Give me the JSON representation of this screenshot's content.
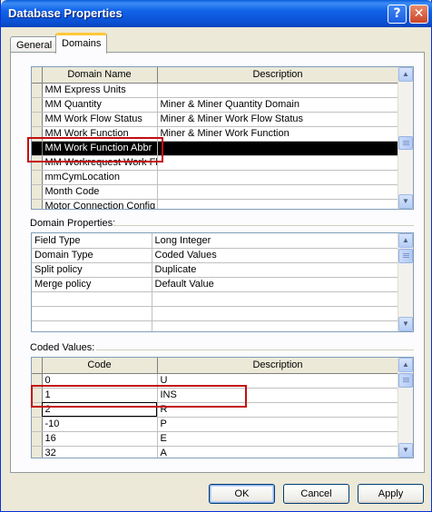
{
  "window": {
    "title": "Database Properties",
    "help_glyph": "?",
    "close_glyph": "✕"
  },
  "tabs": [
    {
      "label": "General",
      "active": false
    },
    {
      "label": "Domains",
      "active": true
    }
  ],
  "domains": {
    "columns": [
      "Domain Name",
      "Description"
    ],
    "rows": [
      {
        "name": "MM Express Units",
        "desc": ""
      },
      {
        "name": "MM Quantity",
        "desc": "Miner & Miner Quantity Domain"
      },
      {
        "name": "MM Work Flow Status",
        "desc": "Miner & Miner Work Flow Status"
      },
      {
        "name": "MM Work Function",
        "desc": "Miner & Miner  Work Function"
      },
      {
        "name": "MM Work Function Abbr",
        "desc": ""
      },
      {
        "name": "MM Workrequest Work Fl",
        "desc": ""
      },
      {
        "name": "mmCymLocation",
        "desc": ""
      },
      {
        "name": "Month Code",
        "desc": ""
      },
      {
        "name": "Motor Connection Config",
        "desc": ""
      }
    ],
    "selected_index": 4
  },
  "domain_properties": {
    "label": "Domain Properties:",
    "rows": [
      {
        "key": "Field Type",
        "value": "Long Integer"
      },
      {
        "key": "Domain Type",
        "value": "Coded Values"
      },
      {
        "key": "Split policy",
        "value": "Duplicate"
      },
      {
        "key": "Merge policy",
        "value": "Default Value"
      },
      {
        "key": "",
        "value": ""
      },
      {
        "key": "",
        "value": ""
      },
      {
        "key": "",
        "value": ""
      }
    ]
  },
  "coded_values": {
    "label": "Coded Values:",
    "columns": [
      "Code",
      "Description"
    ],
    "rows": [
      {
        "code": "0",
        "desc": "U"
      },
      {
        "code": "1",
        "desc": "INS"
      },
      {
        "code": "2",
        "desc": "R"
      },
      {
        "code": "-10",
        "desc": "P"
      },
      {
        "code": "16",
        "desc": "E"
      },
      {
        "code": "32",
        "desc": "A"
      }
    ]
  },
  "buttons": {
    "ok": "OK",
    "cancel": "Cancel",
    "apply": "Apply"
  },
  "scroll_arrows": {
    "up": "▲",
    "down": "▼"
  }
}
